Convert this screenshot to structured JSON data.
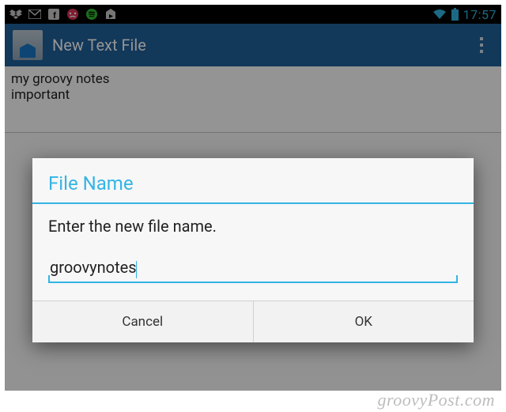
{
  "status_bar": {
    "clock": "17:57",
    "notification_icons": [
      "dropbox",
      "envelope",
      "facebook",
      "emoji-angry",
      "spotify",
      "play-store"
    ]
  },
  "action_bar": {
    "title": "New Text File"
  },
  "editor": {
    "content": "my groovy notes\nimportant"
  },
  "dialog": {
    "title": "File Name",
    "message": "Enter the new file name.",
    "input_value": "groovynotes",
    "buttons": {
      "cancel": "Cancel",
      "ok": "OK"
    }
  },
  "watermark": "groovyPost.com"
}
